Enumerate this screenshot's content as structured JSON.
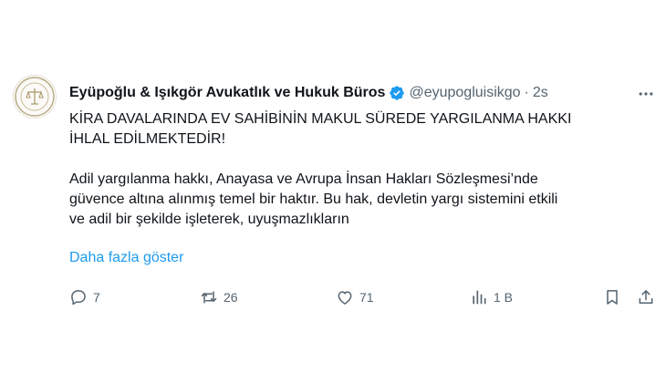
{
  "tweet": {
    "author_name": "Eyüpoğlu & Işıkgör Avukatlık ve Hukuk Büros",
    "handle": "@eyupogluisikgo",
    "separator": "·",
    "time": "2s",
    "text_lines": [
      "KİRA DAVALARINDA EV SAHİBİNİN MAKUL SÜREDE YARGILANMA HAKKI",
      "İHLAL EDİLMEKTEDİR!",
      "Adil yargılanma hakkı, Anayasa ve Avrupa İnsan Hakları Sözleşmesi’nde",
      "güvence altına alınmış temel bir haktır. Bu hak, devletin yargı sistemini etkili",
      "ve adil bir şekilde işleterek, uyuşmazlıkların"
    ],
    "show_more": "Daha fazla göster"
  },
  "actions": {
    "reply_count": "7",
    "retweet_count": "26",
    "like_count": "71",
    "views_count": "1 B"
  },
  "icons": {
    "avatar": "law-firm-logo",
    "verified": "verified-badge-icon",
    "more": "more-horizontal-icon",
    "reply": "reply-icon",
    "retweet": "retweet-icon",
    "like": "heart-icon",
    "views": "views-chart-icon",
    "bookmark": "bookmark-icon",
    "share": "share-icon"
  },
  "colors": {
    "text": "#0f1419",
    "secondary": "#536471",
    "link": "#1d9bf0",
    "verified": "#1d9bf0"
  }
}
